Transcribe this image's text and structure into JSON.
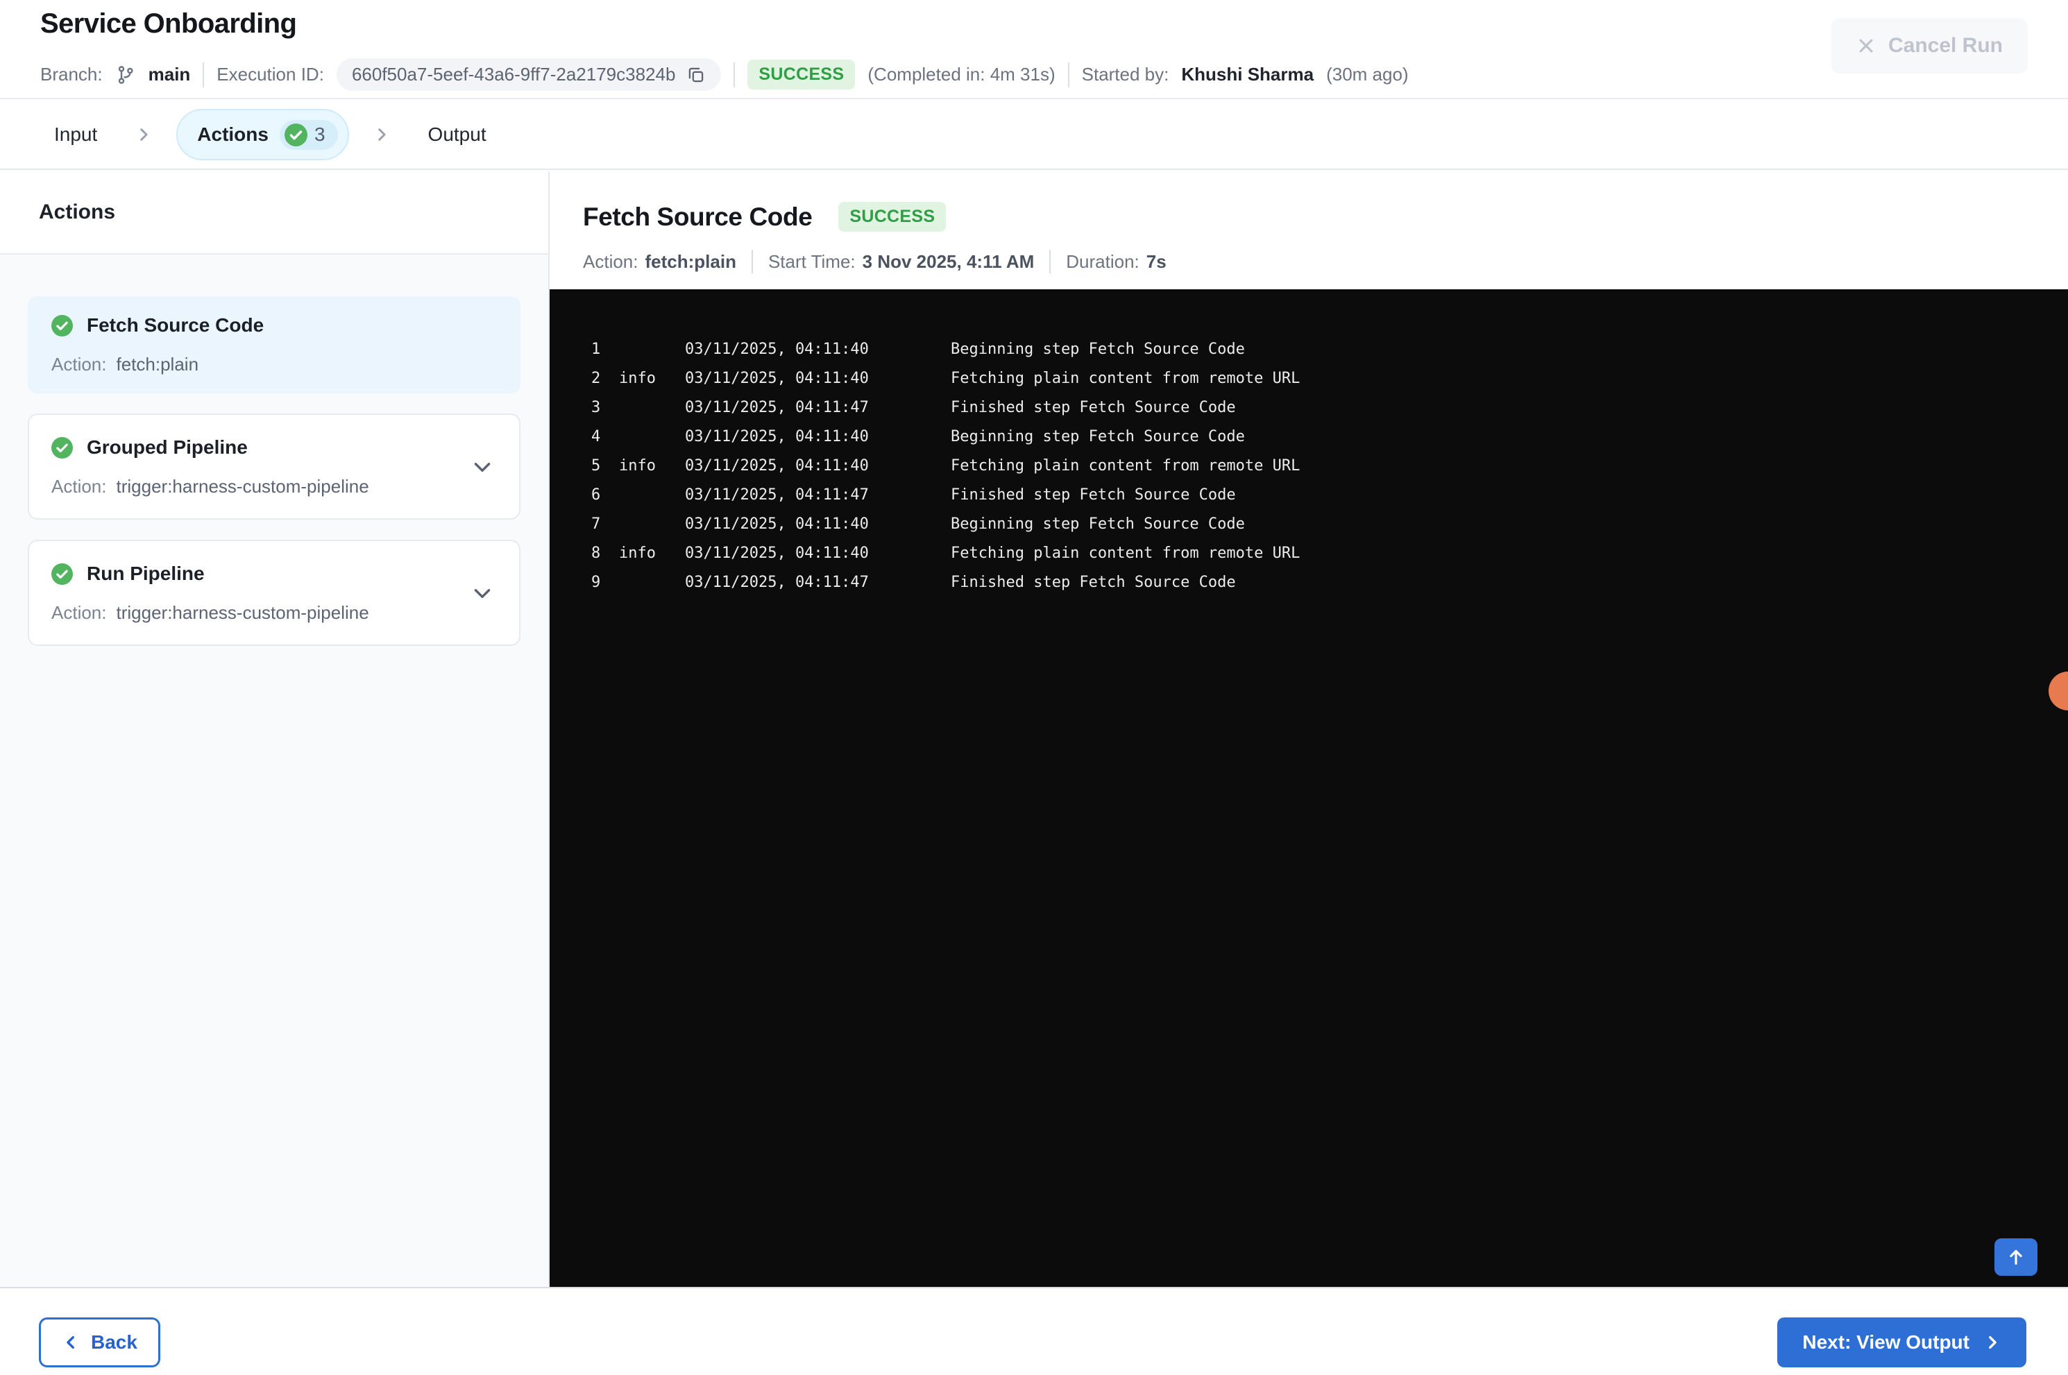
{
  "header": {
    "title": "Service Onboarding",
    "branch_label": "Branch:",
    "branch": "main",
    "execution_id_label": "Execution ID:",
    "execution_id": "660f50a7-5eef-43a6-9ff7-2a2179c3824b",
    "status": "SUCCESS",
    "completed_in": "(Completed in: 4m 31s)",
    "started_by_label": "Started by:",
    "started_by": "Khushi Sharma",
    "started_ago": "(30m ago)",
    "cancel_button": "Cancel Run"
  },
  "tabs": {
    "input": "Input",
    "actions": "Actions",
    "actions_count": "3",
    "output": "Output"
  },
  "sidebar": {
    "title": "Actions",
    "action_label": "Action:",
    "items": [
      {
        "title": "Fetch Source Code",
        "action": "fetch:plain",
        "selected": true,
        "status": "success"
      },
      {
        "title": "Grouped Pipeline",
        "action": "trigger:harness-custom-pipeline",
        "selected": false,
        "status": "success"
      },
      {
        "title": "Run Pipeline",
        "action": "trigger:harness-custom-pipeline",
        "selected": false,
        "status": "success"
      }
    ]
  },
  "detail": {
    "title": "Fetch Source Code",
    "status": "SUCCESS",
    "action_label": "Action:",
    "action": "fetch:plain",
    "start_label": "Start Time:",
    "start": "3 Nov 2025, 4:11 AM",
    "duration_label": "Duration:",
    "duration": "7s"
  },
  "log": {
    "lines": [
      {
        "num": "1",
        "level": "",
        "time": "03/11/2025, 04:11:40",
        "msg": "Beginning step Fetch Source Code"
      },
      {
        "num": "2",
        "level": "info",
        "time": "03/11/2025, 04:11:40",
        "msg": "Fetching plain content from remote URL"
      },
      {
        "num": "3",
        "level": "",
        "time": "03/11/2025, 04:11:47",
        "msg": "Finished step Fetch Source Code"
      },
      {
        "num": "4",
        "level": "",
        "time": "03/11/2025, 04:11:40",
        "msg": "Beginning step Fetch Source Code"
      },
      {
        "num": "5",
        "level": "info",
        "time": "03/11/2025, 04:11:40",
        "msg": "Fetching plain content from remote URL"
      },
      {
        "num": "6",
        "level": "",
        "time": "03/11/2025, 04:11:47",
        "msg": "Finished step Fetch Source Code"
      },
      {
        "num": "7",
        "level": "",
        "time": "03/11/2025, 04:11:40",
        "msg": "Beginning step Fetch Source Code"
      },
      {
        "num": "8",
        "level": "info",
        "time": "03/11/2025, 04:11:40",
        "msg": "Fetching plain content from remote URL"
      },
      {
        "num": "9",
        "level": "",
        "time": "03/11/2025, 04:11:47",
        "msg": "Finished step Fetch Source Code"
      }
    ]
  },
  "footer": {
    "back": "Back",
    "next": "Next: View Output"
  },
  "colors": {
    "primary_blue": "#2e6fd6",
    "success_text": "#2f9e44",
    "success_bg": "#e0f4e1",
    "check_green": "#53b45f",
    "tab_pill_bg": "#e9f8ff",
    "selected_card_bg": "#eaf5fd",
    "console_bg": "#0c0c0c",
    "accent_orange": "#e87a4f"
  }
}
